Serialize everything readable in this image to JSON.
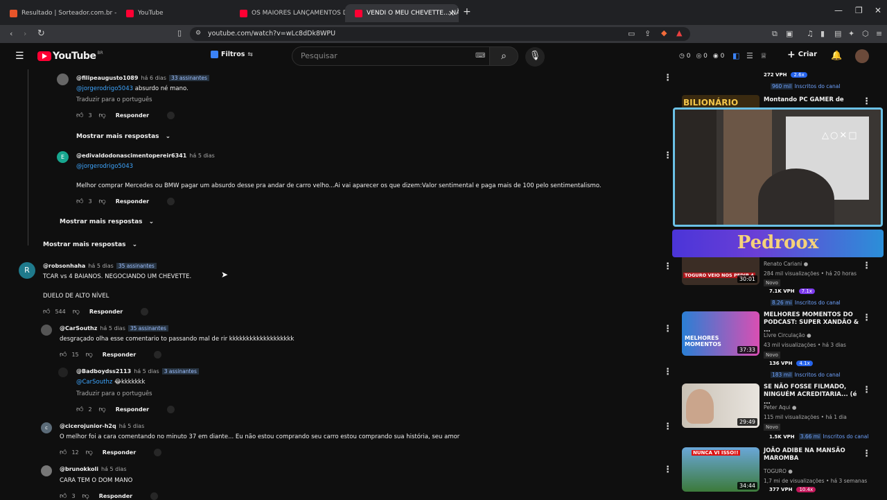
{
  "browser": {
    "tabs": [
      {
        "label": "Resultado | Sorteador.com.br - O Site",
        "color": "#e8552a"
      },
      {
        "label": "YouTube",
        "color": "#ff0033"
      },
      {
        "label": "OS MAIORES LANÇAMENTOS DO CI",
        "color": "#ff0033"
      },
      {
        "label": "VENDI O MEU CHEVETTE... NÃO",
        "color": "#ff0033"
      }
    ],
    "url": "youtube.com/watch?v=wLc8dDk8WPU"
  },
  "yt_header": {
    "logo_text": "YouTube",
    "country": "BR",
    "filters_label": "Filtros",
    "search_placeholder": "Pesquisar",
    "counters": [
      "0",
      "0",
      "0"
    ],
    "create_label": "Criar"
  },
  "comments": [
    {
      "author": "@filipeaugusto1089",
      "time": "há 6 dias",
      "badge": "33 assinantes",
      "mention": "@jorgerodrigo5043",
      "text": " absurdo né mano.",
      "translate": "Traduzir para o português",
      "likes": "3",
      "reply": "Responder"
    },
    {
      "author": "@edivaldodonascimentopereir6341",
      "time": "há 5 dias",
      "badge": "",
      "mention": "@jorgerodrigo5043",
      "text": "Melhor comprar Mercedes ou BMW pagar um absurdo desse pra andar de carro velho...Ai vai aparecer os que dizem:Valor  sentimental e paga mais de 100 pelo sentimentalismo.",
      "likes": "3",
      "reply": "Responder"
    },
    {
      "author": "@robsonhaha",
      "time": "há 5 dias",
      "badge": "35 assinantes",
      "text": "TCAR vs 4 BAIANOS.  NEGOCIANDO UM CHEVETTE.",
      "text2": "DUELO DE ALTO NÍVEL",
      "likes": "544",
      "reply": "Responder"
    },
    {
      "author": "@CarSouthz",
      "time": "há 5 dias",
      "badge": "35 assinantes",
      "text": "desgraçado olha esse comentario to passando mal de rir kkkkkkkkkkkkkkkkkkk",
      "likes": "15",
      "reply": "Responder"
    },
    {
      "author": "@Badboydss2113",
      "time": "há 5 dias",
      "badge": "3 assinantes",
      "mention": "@CarSouthz",
      "text": " 😂kkkkkkk",
      "translate": "Traduzir para o português",
      "likes": "2",
      "reply": "Responder"
    },
    {
      "author": "@cicerojunior-h2q",
      "time": "há 5 dias",
      "badge": "",
      "text": "O melhor foi a cara comentando no minuto 37 em diante... Eu não estou comprando seu carro  estou comprando sua história, seu amor",
      "likes": "12",
      "reply": "Responder"
    },
    {
      "author": "@brunokkoli",
      "time": "há 5 dias",
      "badge": "",
      "text": "CARA TEM O DOM MANO",
      "likes": "3",
      "reply": "Responder"
    }
  ],
  "more_replies": "Mostrar mais respostas",
  "sidebar": {
    "top": {
      "vph": "272 VPH",
      "mult": "2.6x",
      "subs_n": "960 mil",
      "subs_label": "Inscritos do canal"
    },
    "video0": {
      "title": "Montando PC GAMER de",
      "thumb_text": "BILIONÁRIO"
    },
    "overlay_text": "Pedroox",
    "video1": {
      "thumb_text": "TOGURO VEIO NOS PEDIR 4",
      "duration": "30:01",
      "channel": "Renato Cariani",
      "meta": "284 mil visualizações • há 20 horas",
      "new": "Novo",
      "vph": "7.1K VPH",
      "mult": "7.1x",
      "subs_n": "8.26 mi",
      "subs_label": "Inscritos do canal"
    },
    "video2": {
      "title": "MELHORES MOMENTOS DO PODCAST: SUPER XANDÃO & ...",
      "thumb_text": "MELHORES MOMENTOS",
      "duration": "37:33",
      "channel": "Livre Circulação",
      "meta": "43 mil visualizações • há 3 dias",
      "new": "Novo",
      "vph": "136 VPH",
      "mult": "4.1x",
      "subs_n": "183 mil",
      "subs_label": "Inscritos do canal"
    },
    "video3": {
      "title": "SE NÃO FOSSE FILMADO, NINGUÉM ACREDITARIA... (é ...",
      "duration": "29:49",
      "channel": "Peter Aqui",
      "meta": "115 mil visualizações • há 1 dia",
      "new": "Novo",
      "vph": "1.5K VPH",
      "subs_n": "3.66 mi",
      "subs_label": "Inscritos do canal"
    },
    "video4": {
      "title": "JOÃO ADIBE NA MANSÃO MAROMBA",
      "thumb_text": "NUNCA VI ISSO!!",
      "duration": "34:44",
      "channel": "TOGURO",
      "meta": "1,7 mi de visualizações • há 3 semanas",
      "vph": "377 VPH",
      "mult": "10.4x"
    }
  }
}
